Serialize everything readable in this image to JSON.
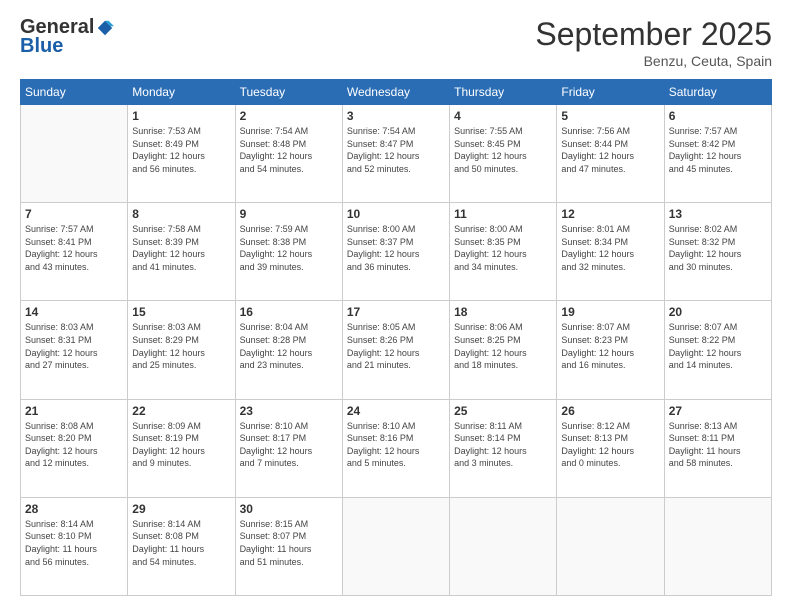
{
  "logo": {
    "general": "General",
    "blue": "Blue"
  },
  "header": {
    "month": "September 2025",
    "location": "Benzu, Ceuta, Spain"
  },
  "weekdays": [
    "Sunday",
    "Monday",
    "Tuesday",
    "Wednesday",
    "Thursday",
    "Friday",
    "Saturday"
  ],
  "weeks": [
    [
      {
        "day": "",
        "info": ""
      },
      {
        "day": "1",
        "info": "Sunrise: 7:53 AM\nSunset: 8:49 PM\nDaylight: 12 hours\nand 56 minutes."
      },
      {
        "day": "2",
        "info": "Sunrise: 7:54 AM\nSunset: 8:48 PM\nDaylight: 12 hours\nand 54 minutes."
      },
      {
        "day": "3",
        "info": "Sunrise: 7:54 AM\nSunset: 8:47 PM\nDaylight: 12 hours\nand 52 minutes."
      },
      {
        "day": "4",
        "info": "Sunrise: 7:55 AM\nSunset: 8:45 PM\nDaylight: 12 hours\nand 50 minutes."
      },
      {
        "day": "5",
        "info": "Sunrise: 7:56 AM\nSunset: 8:44 PM\nDaylight: 12 hours\nand 47 minutes."
      },
      {
        "day": "6",
        "info": "Sunrise: 7:57 AM\nSunset: 8:42 PM\nDaylight: 12 hours\nand 45 minutes."
      }
    ],
    [
      {
        "day": "7",
        "info": "Sunrise: 7:57 AM\nSunset: 8:41 PM\nDaylight: 12 hours\nand 43 minutes."
      },
      {
        "day": "8",
        "info": "Sunrise: 7:58 AM\nSunset: 8:39 PM\nDaylight: 12 hours\nand 41 minutes."
      },
      {
        "day": "9",
        "info": "Sunrise: 7:59 AM\nSunset: 8:38 PM\nDaylight: 12 hours\nand 39 minutes."
      },
      {
        "day": "10",
        "info": "Sunrise: 8:00 AM\nSunset: 8:37 PM\nDaylight: 12 hours\nand 36 minutes."
      },
      {
        "day": "11",
        "info": "Sunrise: 8:00 AM\nSunset: 8:35 PM\nDaylight: 12 hours\nand 34 minutes."
      },
      {
        "day": "12",
        "info": "Sunrise: 8:01 AM\nSunset: 8:34 PM\nDaylight: 12 hours\nand 32 minutes."
      },
      {
        "day": "13",
        "info": "Sunrise: 8:02 AM\nSunset: 8:32 PM\nDaylight: 12 hours\nand 30 minutes."
      }
    ],
    [
      {
        "day": "14",
        "info": "Sunrise: 8:03 AM\nSunset: 8:31 PM\nDaylight: 12 hours\nand 27 minutes."
      },
      {
        "day": "15",
        "info": "Sunrise: 8:03 AM\nSunset: 8:29 PM\nDaylight: 12 hours\nand 25 minutes."
      },
      {
        "day": "16",
        "info": "Sunrise: 8:04 AM\nSunset: 8:28 PM\nDaylight: 12 hours\nand 23 minutes."
      },
      {
        "day": "17",
        "info": "Sunrise: 8:05 AM\nSunset: 8:26 PM\nDaylight: 12 hours\nand 21 minutes."
      },
      {
        "day": "18",
        "info": "Sunrise: 8:06 AM\nSunset: 8:25 PM\nDaylight: 12 hours\nand 18 minutes."
      },
      {
        "day": "19",
        "info": "Sunrise: 8:07 AM\nSunset: 8:23 PM\nDaylight: 12 hours\nand 16 minutes."
      },
      {
        "day": "20",
        "info": "Sunrise: 8:07 AM\nSunset: 8:22 PM\nDaylight: 12 hours\nand 14 minutes."
      }
    ],
    [
      {
        "day": "21",
        "info": "Sunrise: 8:08 AM\nSunset: 8:20 PM\nDaylight: 12 hours\nand 12 minutes."
      },
      {
        "day": "22",
        "info": "Sunrise: 8:09 AM\nSunset: 8:19 PM\nDaylight: 12 hours\nand 9 minutes."
      },
      {
        "day": "23",
        "info": "Sunrise: 8:10 AM\nSunset: 8:17 PM\nDaylight: 12 hours\nand 7 minutes."
      },
      {
        "day": "24",
        "info": "Sunrise: 8:10 AM\nSunset: 8:16 PM\nDaylight: 12 hours\nand 5 minutes."
      },
      {
        "day": "25",
        "info": "Sunrise: 8:11 AM\nSunset: 8:14 PM\nDaylight: 12 hours\nand 3 minutes."
      },
      {
        "day": "26",
        "info": "Sunrise: 8:12 AM\nSunset: 8:13 PM\nDaylight: 12 hours\nand 0 minutes."
      },
      {
        "day": "27",
        "info": "Sunrise: 8:13 AM\nSunset: 8:11 PM\nDaylight: 11 hours\nand 58 minutes."
      }
    ],
    [
      {
        "day": "28",
        "info": "Sunrise: 8:14 AM\nSunset: 8:10 PM\nDaylight: 11 hours\nand 56 minutes."
      },
      {
        "day": "29",
        "info": "Sunrise: 8:14 AM\nSunset: 8:08 PM\nDaylight: 11 hours\nand 54 minutes."
      },
      {
        "day": "30",
        "info": "Sunrise: 8:15 AM\nSunset: 8:07 PM\nDaylight: 11 hours\nand 51 minutes."
      },
      {
        "day": "",
        "info": ""
      },
      {
        "day": "",
        "info": ""
      },
      {
        "day": "",
        "info": ""
      },
      {
        "day": "",
        "info": ""
      }
    ]
  ]
}
